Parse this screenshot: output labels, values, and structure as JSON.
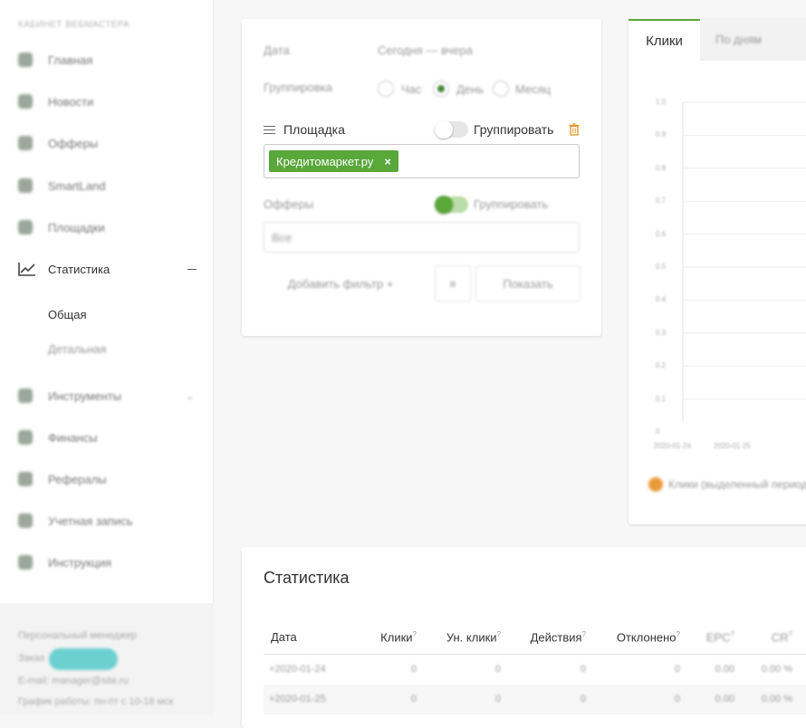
{
  "sidebar": {
    "header": "КАБИНЕТ ВЕБМАСТЕРА",
    "items": [
      {
        "label": "Главная",
        "icon": "home-icon"
      },
      {
        "label": "Новости",
        "icon": "news-icon"
      },
      {
        "label": "Офферы",
        "icon": "offers-icon"
      },
      {
        "label": "SmartLand",
        "icon": "smartland-icon"
      },
      {
        "label": "Площадки",
        "icon": "sites-icon"
      },
      {
        "label": "Статистика",
        "icon": "chart-icon"
      },
      {
        "label": "Инструменты",
        "icon": "tools-icon"
      },
      {
        "label": "Финансы",
        "icon": "finance-icon"
      },
      {
        "label": "Рефералы",
        "icon": "referrals-icon"
      },
      {
        "label": "Учетная запись",
        "icon": "account-icon"
      },
      {
        "label": "Инструкция",
        "icon": "instruction-icon"
      }
    ],
    "sub_items": [
      "Общая",
      "Детальная"
    ],
    "footer": {
      "line1": "Персональный менеджер",
      "line2": "Заказ",
      "button": "Чат",
      "line3": "E-mail: manager@site.ru",
      "line4": "График работы: пн-пт с 10-18 мск"
    }
  },
  "filters": {
    "date_label": "Дата",
    "date_value": "Сегодня — вчера",
    "group_label": "Группировка",
    "group_options": [
      "Час",
      "День",
      "Месяц"
    ],
    "group_selected": 1,
    "platform_label": "Площадка",
    "platform_group_label": "Группировать",
    "platform_tag": "Кредитомаркет.ру",
    "offer_label": "Офферы",
    "offer_group_label": "Группировать",
    "offer_placeholder": "Все",
    "add_filter_label": "Добавить фильтр +",
    "show_label": "Показать"
  },
  "chart_panel": {
    "tab_active": "Клики",
    "tab_inactive": "По дням",
    "legend": "Клики (выделенный период)",
    "color_accent": "#5aa73a",
    "color_legend": "#e89a3a"
  },
  "chart_data": {
    "type": "line",
    "x": [
      "2020-01-24",
      "2020-01-25"
    ],
    "series": [
      {
        "name": "Клики (выделенный период)",
        "values": [
          0,
          0
        ]
      }
    ],
    "ylim": [
      0,
      1
    ],
    "yticks": [
      "1.0",
      "0.9",
      "0.8",
      "0.7",
      "0.6",
      "0.5",
      "0.4",
      "0.3",
      "0.2",
      "0.1",
      "0"
    ],
    "xticks": [
      "2020-01-24",
      "2020-01-25"
    ]
  },
  "stats": {
    "title": "Статистика",
    "columns": [
      "Дата",
      "Клики",
      "Ун. клики",
      "Действия",
      "Отклонено",
      "EPC",
      "CR"
    ],
    "rows": [
      [
        "2020-01-24",
        "0",
        "0",
        "0",
        "0",
        "0.00",
        "0.00 %"
      ],
      [
        "2020-01-25",
        "0",
        "0",
        "0",
        "0",
        "0.00",
        "0.00 %"
      ]
    ]
  }
}
